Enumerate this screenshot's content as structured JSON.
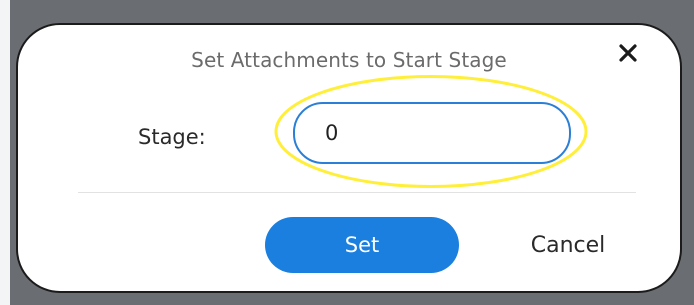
{
  "dialog": {
    "title": "Set Attachments to Start Stage",
    "close_icon": "close-icon",
    "stage_label": "Stage:",
    "stage_value": "0",
    "set_label": "Set",
    "cancel_label": "Cancel"
  },
  "colors": {
    "accent": "#1a7fde",
    "input_border": "#2c7fd6",
    "highlight": "#ffef3a",
    "backdrop": "#6a6d72"
  }
}
